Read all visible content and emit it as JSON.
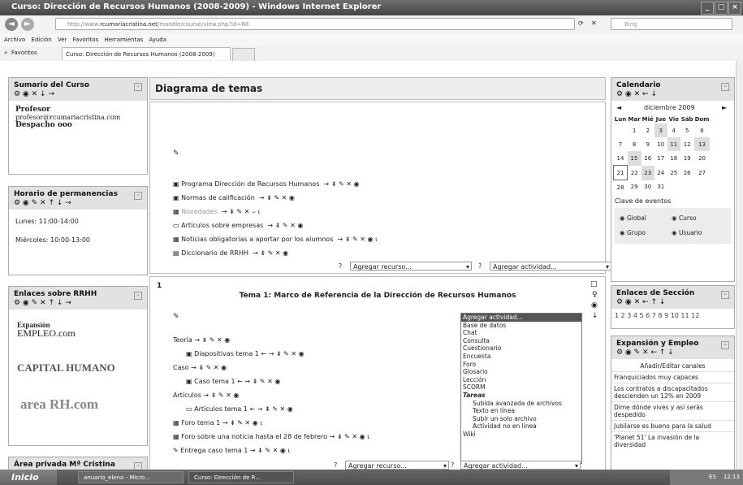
{
  "window": {
    "title": "Curso: Dirección de Recursos Humanos (2008-2009) - Windows Internet Explorer",
    "buttons": [
      "_",
      "□",
      "×"
    ]
  },
  "address": {
    "url_prefix": "http://www.",
    "url_domain": "rcumariacristina.net",
    "url_path": "/moodle/course/view.php?id=68",
    "search_placeholder": "Bing"
  },
  "menu": [
    "Archivo",
    "Edición",
    "Ver",
    "Favoritos",
    "Herramientas",
    "Ayuda"
  ],
  "favbar": {
    "favorites_label": "Favoritos",
    "tab_label": "Curso: Dirección de Recursos Humanos (2008-2009)"
  },
  "left": {
    "sumario": {
      "title": "Sumario del Curso",
      "icons": "⚙ ◉ ✕ ↓ →",
      "name": "Profesor",
      "email": "profesor@rcumariacristina.com",
      "office": "Despacho ooo"
    },
    "horario": {
      "title": "Horario de permanencias",
      "icons": "⚙ ◉ ✎ ✕ ↑ ↓ →",
      "lines": [
        "Lunes: 11:00-14:00",
        "Miércoles: 10:00-13:00"
      ]
    },
    "enlaces": {
      "title": "Enlaces sobre RRHH",
      "icons": "⚙ ◉ ✎ ✕ ↑ ↓ →",
      "logo1a": "Expansión",
      "logo1b": "EMPLEO.com",
      "logo2": "CAPITAL HUMANO",
      "logo3": "area RH.com"
    },
    "privada": {
      "title": "Área privada Mª Cristina",
      "icons": "⚙ ◉ ✎ ✕ ↑ ↓ →"
    }
  },
  "center": {
    "header": "Diagrama de temas",
    "section0": {
      "items": [
        "Programa Dirección de Recursos Humanos",
        "Normas de calificación",
        "Novedades",
        "Artículos sobre empresas",
        "Noticias obligatorias a aportar por los alumnos",
        "Diccionario de RRHH"
      ],
      "item_icons": [
        "→ ⇟ ✎ ✕ ◉",
        "→ ⇟ ✎ ✕ ◉",
        "→ ⇟ ✎ ✕ ⌣ ⍳",
        "→ ⇟ ✎ ✕ ◉",
        "→ ⇟ ✎ ✕ ◉ ⍳",
        "→ ⇟ ✎ ✕ ◉"
      ],
      "add_resource": "Agregar recurso...",
      "add_activity": "Agregar actividad..."
    },
    "section1": {
      "number": "1",
      "title": "Tema 1: Marco de Referencia de la Dirección de Recursos Humanos",
      "items": [
        "Teoría",
        "Diapositivas tema 1",
        "Caso",
        "Caso tema 1",
        "Artículos",
        "Artículos tema 1",
        "Foro tema 1",
        "Foro sobre una noticia hasta el 28 de febrero",
        "Entrega caso tema 1"
      ],
      "item_icons": [
        "→ ⇟ ✎ ✕ ◉",
        "← → ⇟ ✎ ✕ ◉",
        "→ ⇟ ✎ ✕ ◉",
        "← → ⇟ ✎ ✕ ◉",
        "→ ⇟ ✎ ✕ ◉",
        "← → ⇟ ✎ ✕ ◉",
        "→ ⇟ ✎ ✕ ◉ ⍳",
        "→ ⇟ ✎ ✕ ◉ ⍳",
        "→ ⇟ ✎ ✕ ◉ ⍳"
      ],
      "dropdown": [
        "Agregar actividad...",
        "Base de datos",
        "Chat",
        "Consulta",
        "Cuestionario",
        "Encuesta",
        "Foro",
        "Glosario",
        "Lección",
        "SCORM",
        "Tareas",
        "Subida avanzada de archivos",
        "Texto en línea",
        "Subir un solo archivo",
        "Actividad no en línea",
        "Wiki"
      ],
      "add_resource": "Agregar recurso...",
      "add_activity": "Agregar actividad..."
    }
  },
  "right": {
    "calendar": {
      "title": "Calendario",
      "icons": "⚙ ◉ ✕ ← ↓",
      "month": "diciembre 2009",
      "prev": "◄",
      "next": "►",
      "days": [
        "Lun",
        "Mar",
        "Mié",
        "Jue",
        "Vie",
        "Sáb",
        "Dom"
      ],
      "weeks": [
        [
          "",
          "1",
          "2",
          "3",
          "4",
          "5",
          "6"
        ],
        [
          "7",
          "8",
          "9",
          "10",
          "11",
          "12",
          "13"
        ],
        [
          "14",
          "15",
          "16",
          "17",
          "18",
          "19",
          "20"
        ],
        [
          "21",
          "22",
          "23",
          "24",
          "25",
          "26",
          "27"
        ],
        [
          "28",
          "29",
          "30",
          "31",
          "",
          "",
          ""
        ]
      ],
      "events_title": "Clave de eventos",
      "events": [
        "Global",
        "Curso",
        "Grupo",
        "Usuario"
      ]
    },
    "seccion": {
      "title": "Enlaces de Sección",
      "icons": "⚙ ◉ ✕ ← ↑ ↓",
      "numbers": "1 2 3 4 5 6 7 8 9 10 11 12"
    },
    "expansion": {
      "title": "Expansión y Empleo",
      "icons": "⚙ ◉ ✎ ✕ ← ↑ ↓",
      "add": "Añadir/Editar canales",
      "items": [
        "Franquiciados muy capaces",
        "Los contratos a discapacitados descienden un 12% en 2009",
        "Dime dónde vives y así serás despedido",
        "Jubilarse es bueno para la salud",
        "'Planet 51' La invasión de la diversidad"
      ]
    }
  },
  "taskbar": {
    "start": "Inicio",
    "tasks": [
      "anuario_elena - Micro...",
      "Curso: Dirección de R..."
    ],
    "clock": "12:13",
    "lang": "ES"
  }
}
